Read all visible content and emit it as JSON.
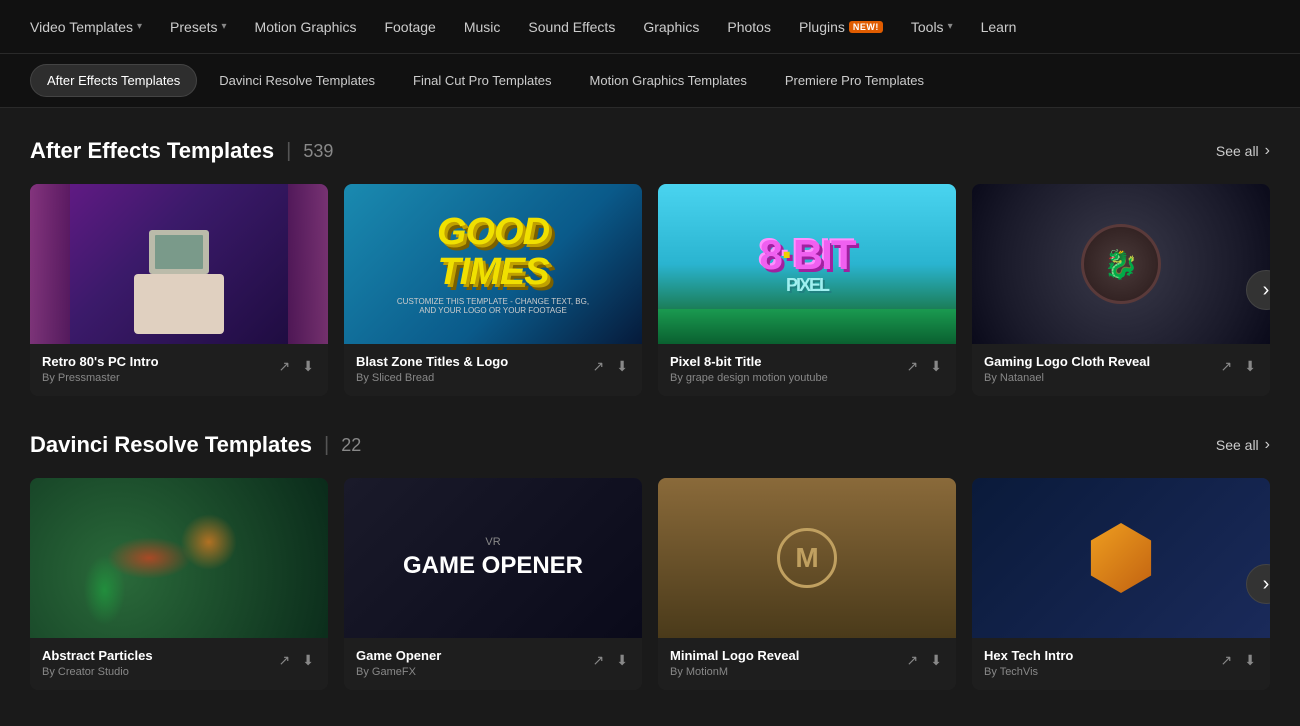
{
  "nav": {
    "items": [
      {
        "label": "Video Templates",
        "hasChevron": true,
        "badge": null
      },
      {
        "label": "Presets",
        "hasChevron": true,
        "badge": null
      },
      {
        "label": "Motion Graphics",
        "hasChevron": false,
        "badge": null
      },
      {
        "label": "Footage",
        "hasChevron": false,
        "badge": null
      },
      {
        "label": "Music",
        "hasChevron": false,
        "badge": null
      },
      {
        "label": "Sound Effects",
        "hasChevron": false,
        "badge": null
      },
      {
        "label": "Graphics",
        "hasChevron": false,
        "badge": null
      },
      {
        "label": "Photos",
        "hasChevron": false,
        "badge": null
      },
      {
        "label": "Plugins",
        "hasChevron": false,
        "badge": "NEW!"
      },
      {
        "label": "Tools",
        "hasChevron": true,
        "badge": null
      },
      {
        "label": "Learn",
        "hasChevron": false,
        "badge": null
      }
    ]
  },
  "subNav": {
    "pills": [
      {
        "label": "After Effects Templates",
        "active": true
      },
      {
        "label": "Davinci Resolve Templates",
        "active": false
      },
      {
        "label": "Final Cut Pro Templates",
        "active": false
      },
      {
        "label": "Motion Graphics Templates",
        "active": false
      },
      {
        "label": "Premiere Pro Templates",
        "active": false
      }
    ]
  },
  "sections": [
    {
      "id": "after-effects",
      "title": "After Effects Templates",
      "count": "539",
      "seeAll": "See all",
      "cards": [
        {
          "id": "retro-80s",
          "title": "Retro 80's PC Intro",
          "author": "By Pressmaster",
          "thumbType": "retro"
        },
        {
          "id": "blast-zone",
          "title": "Blast Zone Titles & Logo",
          "author": "By Sliced Bread",
          "thumbType": "blast"
        },
        {
          "id": "pixel-8bit",
          "title": "Pixel 8-bit Title",
          "author": "By grape design motion youtube",
          "thumbType": "pixel"
        },
        {
          "id": "gaming-logo",
          "title": "Gaming Logo Cloth Reveal",
          "author": "By Natanael",
          "thumbType": "gaming"
        }
      ]
    },
    {
      "id": "davinci-resolve",
      "title": "Davinci Resolve Templates",
      "count": "22",
      "seeAll": "See all",
      "cards": [
        {
          "id": "davinci-1",
          "title": "Abstract Particles",
          "author": "By Creator Studio",
          "thumbType": "davinci1"
        },
        {
          "id": "davinci-2",
          "title": "Game Opener",
          "author": "By GameFX",
          "thumbType": "davinci2"
        },
        {
          "id": "davinci-3",
          "title": "Minimal Logo Reveal",
          "author": "By MotionM",
          "thumbType": "davinci3"
        },
        {
          "id": "davinci-4",
          "title": "Hex Tech Intro",
          "author": "By TechVis",
          "thumbType": "davinci4"
        }
      ]
    }
  ],
  "icons": {
    "share": "↗",
    "download": "⬇",
    "chevronRight": "›"
  }
}
